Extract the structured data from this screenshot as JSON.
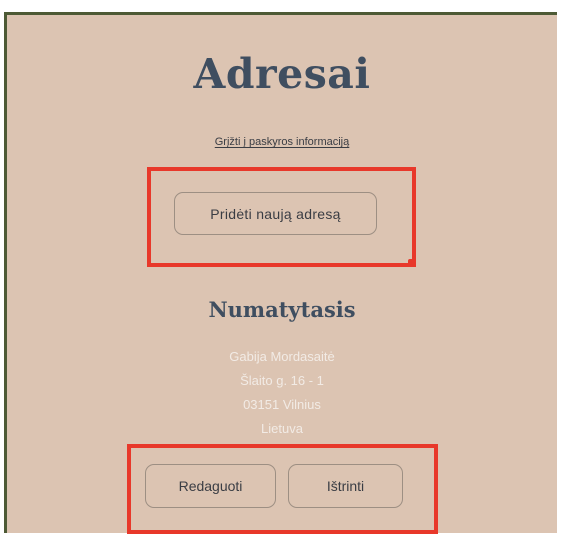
{
  "page": {
    "title": "Adresai",
    "back_link": "Grįžti į paskyros informaciją",
    "add_button": "Pridėti naują adresą"
  },
  "default_address": {
    "heading": "Numatytasis",
    "lines": [
      "Gabija Mordasaitė",
      "Šlaito g. 16 - 1",
      "03151 Vilnius",
      "Lietuva"
    ]
  },
  "actions": {
    "edit_label": "Redaguoti",
    "delete_label": "Ištrinti"
  },
  "colors": {
    "panel_background": "#dcc4b2",
    "panel_border": "#4d5a35",
    "heading_text": "#3f4e60",
    "address_text": "#f2ebe5",
    "highlight": "#e8382a"
  }
}
